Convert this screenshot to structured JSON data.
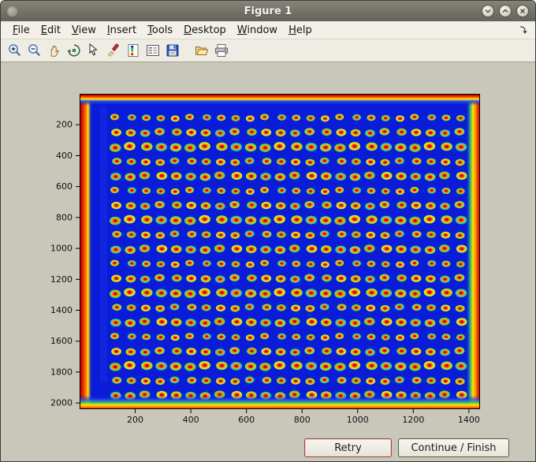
{
  "window": {
    "title": "Figure 1",
    "controls": {
      "minimize": "minimize",
      "maximize": "maximize",
      "close": "close"
    }
  },
  "menu": {
    "items": [
      "File",
      "Edit",
      "View",
      "Insert",
      "Tools",
      "Desktop",
      "Window",
      "Help"
    ]
  },
  "toolbar": {
    "icons": [
      "zoom-in",
      "zoom-out",
      "pan",
      "rotate-3d",
      "data-cursor",
      "brush",
      "colorbar",
      "legend",
      "save",
      "open",
      "print"
    ]
  },
  "buttons": {
    "retry_label": "Retry",
    "continue_label": "Continue / Finish"
  },
  "chart_data": {
    "type": "heatmap",
    "title": "",
    "xlabel": "",
    "ylabel": "",
    "colormap": "jet",
    "x_ticks": [
      200,
      400,
      600,
      800,
      1000,
      1200,
      1400
    ],
    "y_ticks": [
      200,
      400,
      600,
      800,
      1000,
      1200,
      1400,
      1600,
      1800,
      2000
    ],
    "xlim": [
      0,
      1440
    ],
    "ylim": [
      0,
      2040
    ],
    "grid": {
      "rows": 20,
      "cols": 24,
      "x_start": 130,
      "x_end": 1370,
      "y_start": 155,
      "y_end": 1950,
      "spot_halo_colors": [
        "#9ce32c",
        "#5bd44b",
        "#33cf9e",
        "#c6ef32",
        "#7ddd55"
      ],
      "spot_ring_color": "#ffa200",
      "spot_core_color": "#e81600",
      "spot_center_color": "#b00000"
    },
    "colors": {
      "base": "#0a1cd8",
      "cool_light": "#2a52f5",
      "warm_green": "#35c96a",
      "hot_yellow": "#ffe600",
      "hot_orange": "#ff7a00",
      "hot_red": "#e01800",
      "hot_dark": "#990000"
    },
    "description": "Pseudocolor (jet) scan image: 24 x 20 grid of hot spots (red cores, orange rings, green-yellow halos) on deep blue background with hot red/orange image edges"
  }
}
